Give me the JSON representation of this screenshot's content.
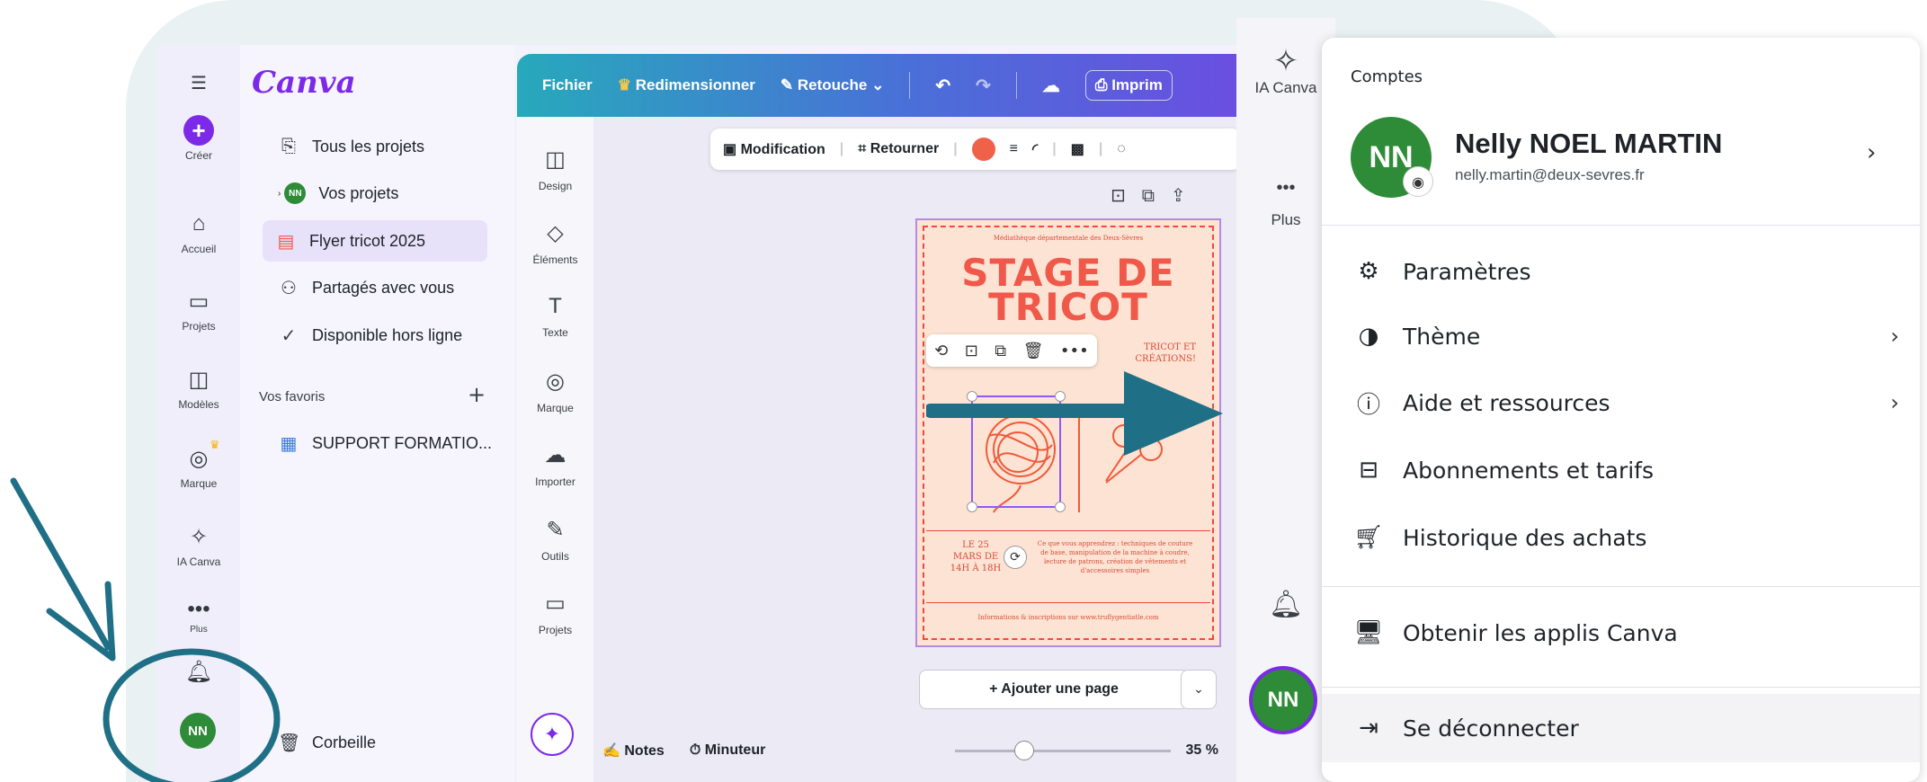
{
  "app": {
    "logo": "Canva"
  },
  "left_rail": {
    "items": [
      {
        "label": "Créer"
      },
      {
        "label": "Accueil"
      },
      {
        "label": "Projets"
      },
      {
        "label": "Modèles"
      },
      {
        "label": "Marque"
      },
      {
        "label": "IA Canva"
      },
      {
        "label": "Plus"
      }
    ],
    "avatar_initials": "NN"
  },
  "projects_panel": {
    "items": [
      {
        "label": "Tous les projets",
        "icon": "folder-icon"
      },
      {
        "label": "Vos projets",
        "icon": "user-avatar"
      },
      {
        "label": "Flyer tricot 2025",
        "icon": "flyer-thumbnail"
      },
      {
        "label": "Partagés avec vous",
        "icon": "people-icon"
      },
      {
        "label": "Disponible hors ligne",
        "icon": "offline-check-icon"
      }
    ],
    "favorites_label": "Vos favoris",
    "favorites_add": "+",
    "favorites": [
      {
        "label": "SUPPORT FORMATIO..."
      }
    ],
    "trash_label": "Corbeille"
  },
  "top_bar": {
    "file": "Fichier",
    "resize": "Redimensionner",
    "edit": "Retouche",
    "print": "Imprim"
  },
  "tools": [
    {
      "label": "Design"
    },
    {
      "label": "Éléments"
    },
    {
      "label": "Texte"
    },
    {
      "label": "Marque"
    },
    {
      "label": "Importer"
    },
    {
      "label": "Outils"
    },
    {
      "label": "Projets"
    }
  ],
  "context_toolbar": {
    "modify": "Modification",
    "flip": "Retourner",
    "color": "#f0614a"
  },
  "flyer": {
    "header": "Médiathèque départementale des Deux-Sèvres",
    "title_line1": "STAGE DE",
    "title_line2": "TRICOT",
    "subtitle_line1": "TRICOT ET",
    "subtitle_line2": "CRÉATIONS!",
    "date_line1": "LE 25",
    "date_line2": "MARS DE",
    "date_line3": "14H À 18H",
    "description": "Ce que vous apprendrez : techniques de couture de base, manipulation de la machine à coudre, lecture de patrons, création de vêtements et d'accessoires simples",
    "footer": "Informations & inscriptions sur www.truflygentiatle.com"
  },
  "canvas": {
    "add_page": "+ Ajouter une page",
    "add_page_menu_icon": "chevron-down"
  },
  "bottom_bar": {
    "notes": "Notes",
    "timer": "Minuteur",
    "zoom": "35 %"
  },
  "right_rail": {
    "ia_label": "IA Canva",
    "more_label": "Plus",
    "avatar_initials": "NN"
  },
  "account_menu": {
    "heading": "Comptes",
    "avatar_initials": "NN",
    "name": "Nelly NOEL MARTIN",
    "email": "nelly.martin@deux-sevres.fr",
    "items": [
      {
        "label": "Paramètres",
        "icon": "gear-icon",
        "chevron": false
      },
      {
        "label": "Thème",
        "icon": "theme-icon",
        "chevron": true
      },
      {
        "label": "Aide et ressources",
        "icon": "info-icon",
        "chevron": true
      },
      {
        "label": "Abonnements et tarifs",
        "icon": "briefcase-icon",
        "chevron": false
      },
      {
        "label": "Historique des achats",
        "icon": "cart-icon",
        "chevron": false
      },
      {
        "label": "Obtenir les applis Canva",
        "icon": "monitor-icon",
        "chevron": false
      },
      {
        "label": "Se déconnecter",
        "icon": "logout-icon",
        "chevron": false
      }
    ]
  },
  "colors": {
    "brand_purple": "#7d2ae8",
    "avatar_green": "#2e8b37",
    "annotation_teal": "#1f6f86",
    "flyer_red": "#f0584a"
  }
}
